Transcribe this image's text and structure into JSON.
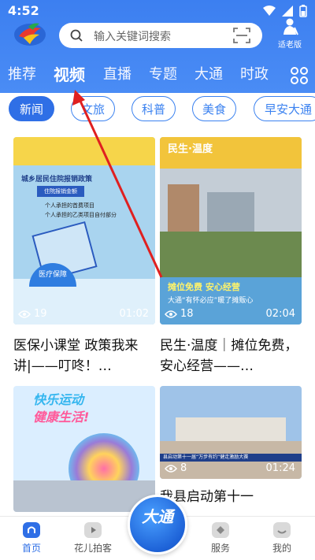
{
  "status": {
    "time": "4:52"
  },
  "search": {
    "placeholder": "输入关键词搜索"
  },
  "elder_mode": {
    "label": "适老版"
  },
  "tabs": [
    {
      "label": "推荐"
    },
    {
      "label": "视频"
    },
    {
      "label": "直播"
    },
    {
      "label": "专题"
    },
    {
      "label": "大通"
    },
    {
      "label": "时政"
    }
  ],
  "chips": [
    {
      "label": "新闻"
    },
    {
      "label": "文旅"
    },
    {
      "label": "科普"
    },
    {
      "label": "美食"
    },
    {
      "label": "早安大通"
    }
  ],
  "videos": [
    {
      "views": "19",
      "duration": "01:02",
      "title": "医保小课堂 政策我来讲|——叮咚！…",
      "thumb_lines": [
        "城乡居民住院报销政策",
        "住院报销金额",
        "个人承担的首费项目",
        "个人承担的乙类项目自付部分",
        "医疗保障"
      ]
    },
    {
      "views": "18",
      "duration": "02:04",
      "title": "民生·温度｜摊位免费，安心经营——…",
      "thumb_lines": [
        "民生·温度",
        "摊位免费 安心经营",
        "大通“有怀必应”暖了摊贩心"
      ]
    },
    {
      "views": "",
      "duration": "",
      "title": "",
      "thumb_lines": [
        "快乐运动",
        "健康生活!"
      ]
    },
    {
      "views": "8",
      "duration": "01:24",
      "title": "我县启动第十一",
      "thumb_lines": [
        "县启动第十一届“万步有约”健走激励大赛"
      ]
    }
  ],
  "center_badge": {
    "text": "大通"
  },
  "bottom_nav": [
    {
      "label": "首页"
    },
    {
      "label": "花儿拍客"
    },
    {
      "label": "服务"
    },
    {
      "label": "我的"
    }
  ],
  "colors": {
    "brand_blue": "#3c7ff0",
    "active_chip": "#2f6fe6",
    "annotation_red": "#e02020"
  }
}
